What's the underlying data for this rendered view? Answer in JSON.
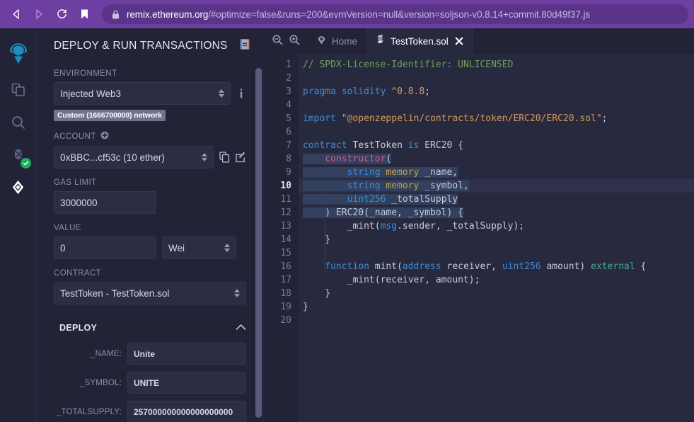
{
  "browser": {
    "back_icon": "arrow-left-icon",
    "forward_icon": "arrow-right-icon",
    "reload_icon": "reload-icon",
    "bookmark_icon": "bookmark-icon",
    "lock_icon": "lock-icon",
    "url_host": "remix.ethereum.org",
    "url_path": "/#optimize=false&runs=200&evmVersion=null&version=soljson-v0.8.14+commit.80d49f37.js"
  },
  "rail": {
    "items": [
      {
        "name": "remix-logo-icon",
        "label": "Remix"
      },
      {
        "name": "file-explorer-icon",
        "label": "File explorers"
      },
      {
        "name": "search-icon",
        "label": "Search in files"
      },
      {
        "name": "solidity-compiler-icon",
        "label": "Solidity compiler"
      },
      {
        "name": "deploy-run-icon",
        "label": "Deploy & run transactions"
      }
    ]
  },
  "panel": {
    "title": "DEPLOY & RUN TRANSACTIONS",
    "header_icon": "document-icon",
    "environment": {
      "label": "ENVIRONMENT",
      "value": "Injected Web3",
      "info_icon": "info-icon",
      "network_badge": "Custom (1666700000) network"
    },
    "account": {
      "label": "ACCOUNT",
      "add_icon": "plus-circle-icon",
      "value": "0xBBC...cf53c (10 ether)",
      "copy_icon": "copy-icon",
      "sign_icon": "edit-sign-icon"
    },
    "gas_limit": {
      "label": "GAS LIMIT",
      "value": "3000000"
    },
    "value_field": {
      "label": "VALUE",
      "value": "0",
      "unit": "Wei"
    },
    "contract": {
      "label": "CONTRACT",
      "value": "TestToken - TestToken.sol"
    },
    "deploy": {
      "title": "DEPLOY",
      "collapse_icon": "chevron-up-icon",
      "args": [
        {
          "label": "_NAME:",
          "value": "Unite"
        },
        {
          "label": "_SYMBOL:",
          "value": "UNITE"
        },
        {
          "label": "_TOTALSUPPLY:",
          "value": "257000000000000000000"
        }
      ]
    }
  },
  "editor": {
    "zoom_out_icon": "zoom-out-icon",
    "zoom_in_icon": "zoom-in-icon",
    "tabs": [
      {
        "label": "Home",
        "icon": "remix-home-icon",
        "active": false,
        "closable": false
      },
      {
        "label": "TestToken.sol",
        "icon": "solidity-file-icon",
        "active": true,
        "closable": true
      }
    ],
    "line_numbers": [
      1,
      2,
      3,
      4,
      5,
      6,
      7,
      8,
      9,
      10,
      11,
      12,
      13,
      14,
      15,
      16,
      17,
      18,
      19,
      20
    ],
    "active_line": 10,
    "code": [
      "// SPDX-License-Identifier: UNLICENSED",
      "",
      "pragma solidity ^0.8.8;",
      "",
      "import \"@openzeppelin/contracts/token/ERC20/ERC20.sol\";",
      "",
      "contract TestToken is ERC20 {",
      "    constructor(",
      "        string memory _name,",
      "        string memory _symbol,",
      "        uint256 _totalSupply",
      "    ) ERC20(_name, _symbol) {",
      "        _mint(msg.sender, _totalSupply);",
      "    }",
      "",
      "    function mint(address receiver, uint256 amount) external {",
      "        _mint(receiver, amount);",
      "    }",
      "}",
      ""
    ]
  },
  "colors": {
    "browser_chrome": "#6c3fa0",
    "panel_bg": "#222336",
    "editor_bg": "#272a3f",
    "input_bg": "#2b2d42",
    "selection": "#33405e",
    "active_line": "#2e3149",
    "accent_green": "#21ad64",
    "comment": "#6f9f5e",
    "keyword": "#3f8bd6",
    "keyword2": "#d75d8a",
    "string": "#d99a55"
  }
}
